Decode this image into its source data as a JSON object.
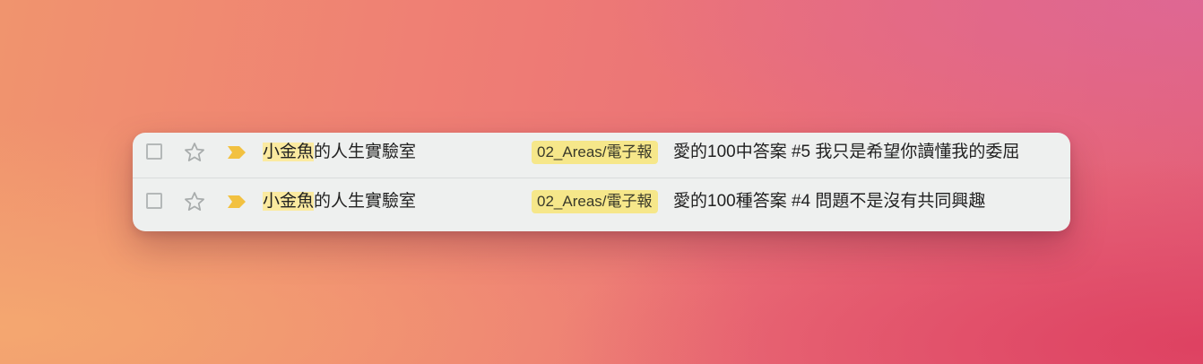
{
  "colors": {
    "sender_highlight": "#fbeaa0",
    "label_background": "#f6e78a",
    "importance_marker": "#f2c140"
  },
  "email_list": {
    "rows": [
      {
        "selected": false,
        "starred": false,
        "important": true,
        "sender_highlight": "小金魚",
        "sender_rest": "的人生實驗室",
        "label": "02_Areas/電子報",
        "subject": "愛的100中答案 #5 我只是希望你讀懂我的委屈"
      },
      {
        "selected": false,
        "starred": false,
        "important": true,
        "sender_highlight": "小金魚",
        "sender_rest": "的人生實驗室",
        "label": "02_Areas/電子報",
        "subject": "愛的100種答案 #4 問題不是沒有共同興趣"
      }
    ]
  }
}
